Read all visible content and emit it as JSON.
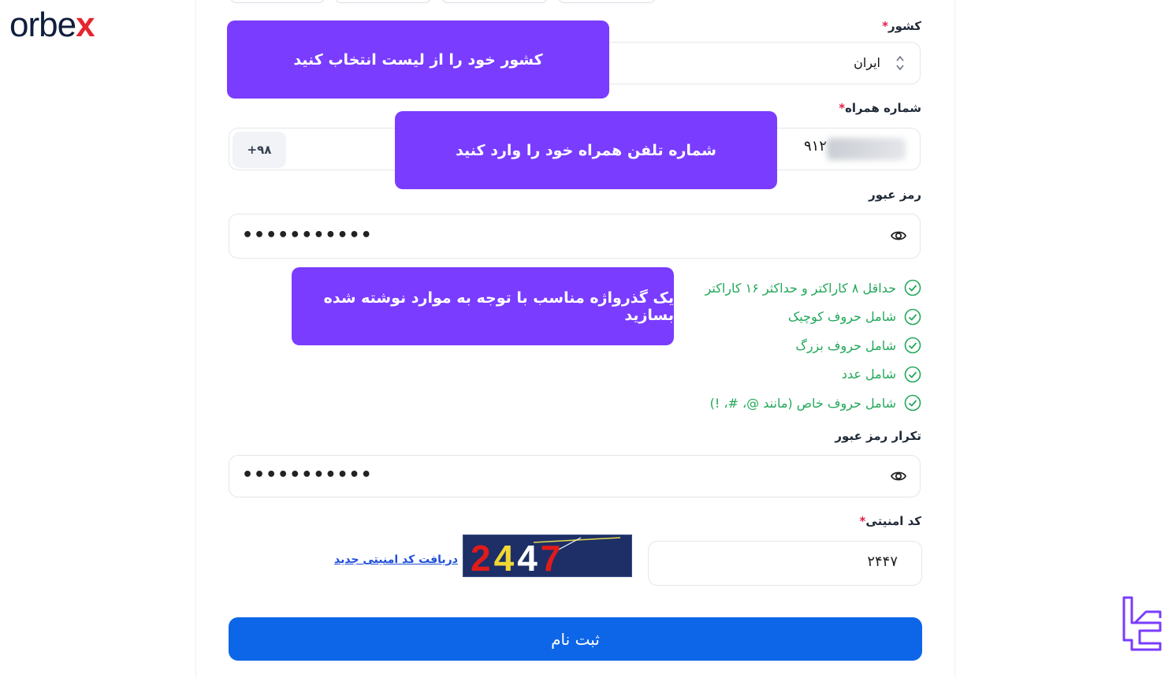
{
  "brand": {
    "logo_text_a": "orbe",
    "logo_text_x": "x",
    "logo_color": "#0f1e3d",
    "logo_accent": "#e3262f"
  },
  "form": {
    "country": {
      "label": "کشور",
      "required_mark": "*",
      "value": "ایران"
    },
    "phone": {
      "label": "شماره همراه",
      "required_mark": "*",
      "prefix": "+۹۸",
      "value_visible": "۹۱۲"
    },
    "password": {
      "label": "رمز عبور",
      "masked": "•••••••••••"
    },
    "rules": [
      {
        "text": "حداقل ۸ کاراکتر و حداکثر ۱۶ کاراکتر"
      },
      {
        "text": "شامل حروف کوچیک"
      },
      {
        "text": "شامل حروف بزرگ"
      },
      {
        "text": "شامل عدد"
      },
      {
        "text": "شامل حروف خاص (مانند @، #، !)"
      }
    ],
    "confirm_password": {
      "label": "تکرار رمز عبور",
      "masked": "•••••••••••"
    },
    "captcha": {
      "label": "کد امنیتی",
      "required_mark": "*",
      "value": "۲۴۴۷",
      "image_text": "2447",
      "refresh_link": "دریافت کد امنیتی جدید"
    },
    "submit_label": "ثبت نام"
  },
  "callouts": {
    "country": "کشور خود را از لیست انتخاب کنید",
    "phone": "شماره تلفن همراه خود را وارد کنید",
    "password": "یک گذرواژه مناسب با توجه به موارد نوشته شده بسازید"
  },
  "colors": {
    "accent_purple": "#7a3cff",
    "primary_blue": "#0d66e8",
    "success_green": "#22a85a",
    "required_red": "#e11d48"
  },
  "icons": [
    "updown-chevron-icon",
    "eye-icon",
    "check-circle-icon",
    "brand-mark-icon"
  ]
}
